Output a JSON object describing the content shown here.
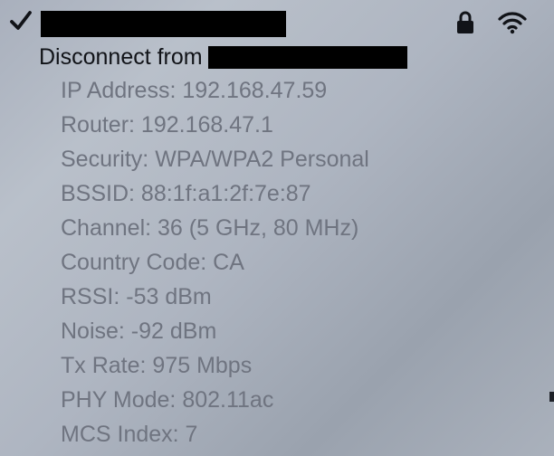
{
  "menu": {
    "icons": {
      "checkmark": "checkmark-icon",
      "lock": "lock-icon",
      "wifi": "wifi-icon"
    },
    "disconnect_label": "Disconnect from",
    "details": [
      "IP Address: 192.168.47.59",
      "Router: 192.168.47.1",
      "Security: WPA/WPA2 Personal",
      "BSSID: 88:1f:a1:2f:7e:87",
      "Channel: 36 (5 GHz, 80 MHz)",
      "Country Code: CA",
      "RSSI: -53 dBm",
      "Noise: -92 dBm",
      "Tx Rate: 975 Mbps",
      "PHY Mode: 802.11ac",
      "MCS Index: 7"
    ]
  },
  "colors": {
    "background": "#aeb5c1",
    "primary_text": "#111318",
    "secondary_text": "#6f7480"
  }
}
